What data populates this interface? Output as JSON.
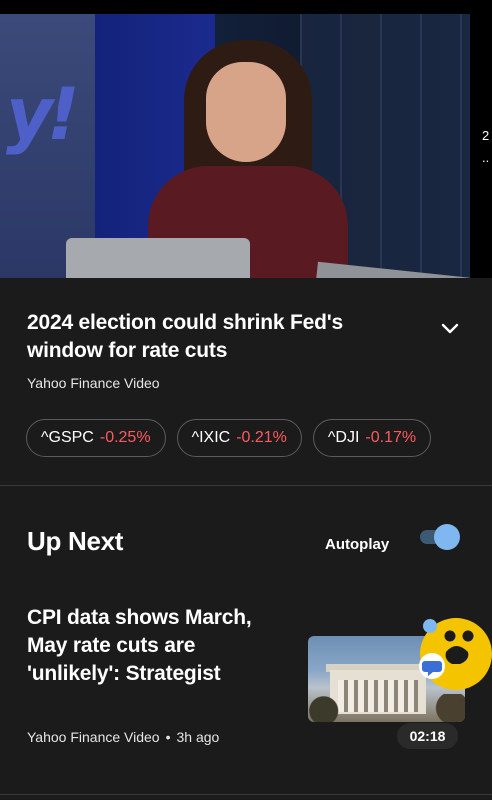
{
  "video": {
    "logo_text": "y!",
    "side_peek": [
      "2",
      ".."
    ]
  },
  "article": {
    "headline": "2024 election could shrink Fed's window for rate cuts",
    "source": "Yahoo Finance Video"
  },
  "tickers": [
    {
      "symbol": "^GSPC",
      "change": "-0.25%"
    },
    {
      "symbol": "^IXIC",
      "change": "-0.21%"
    },
    {
      "symbol": "^DJI",
      "change": "-0.17%"
    }
  ],
  "up_next": {
    "heading": "Up Next",
    "autoplay_label": "Autoplay",
    "autoplay_on": true,
    "item": {
      "title": "CPI data shows March, May rate cuts are 'unlikely': Strategist",
      "source": "Yahoo Finance Video",
      "separator": "•",
      "age": "3h ago",
      "duration": "02:18"
    }
  },
  "colors": {
    "background": "#1b1b1b",
    "negative": "#ff5a5f",
    "toggle_knob": "#7fb8f0",
    "emoji_yellow": "#f5c400"
  },
  "icons": {
    "expand": "chevron-down-icon",
    "assistant": "emoji-assistant-icon"
  }
}
